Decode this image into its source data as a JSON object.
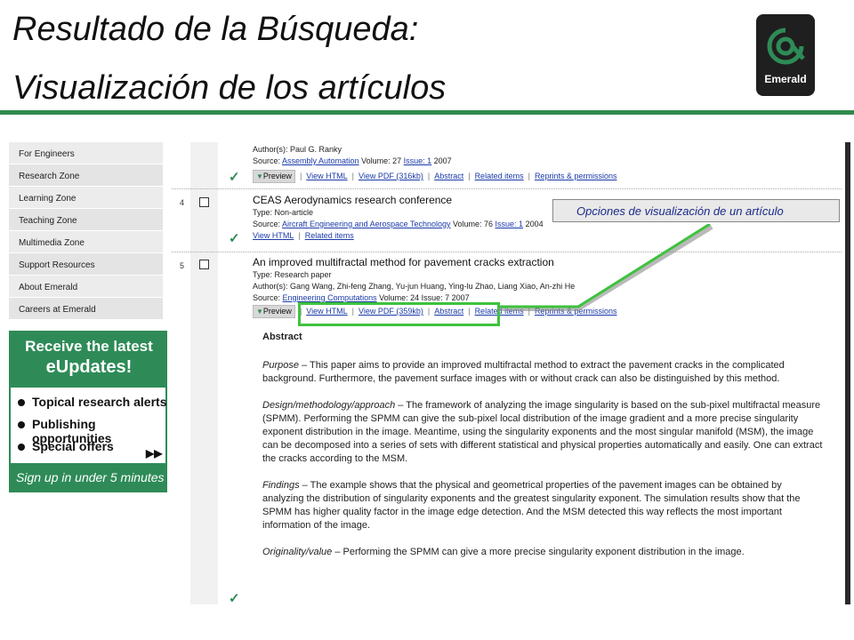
{
  "slide": {
    "title_line1": "Resultado de la Búsqueda:",
    "title_line2": "Visualización de los artículos",
    "logo_text": "Emerald",
    "callout": "Opciones de visualización de un artículo"
  },
  "colors": {
    "accent_green": "#2e8b57",
    "rule_green": "#2f8a4d",
    "link_blue": "#1a3aa8"
  },
  "sidebar": {
    "items": [
      {
        "label": "For Engineers"
      },
      {
        "label": "Research Zone"
      },
      {
        "label": "Learning Zone"
      },
      {
        "label": "Teaching Zone"
      },
      {
        "label": "Multimedia Zone"
      },
      {
        "label": "Support Resources"
      },
      {
        "label": "About Emerald"
      },
      {
        "label": "Careers at Emerald"
      }
    ]
  },
  "promo": {
    "head1": "Receive the latest",
    "head2": "eUpdates!",
    "bullets": [
      "Topical research alerts",
      "Publishing opportunities",
      "Special offers"
    ],
    "footer": "Sign up in under 5 minutes"
  },
  "results": {
    "r3": {
      "authors": "Author(s): Paul G. Ranky",
      "source_label": "Source: ",
      "source_journal": "Assembly Automation",
      "source_volume": " Volume: 27 ",
      "source_issue": "Issue: 1",
      "source_year": " 2007",
      "preview": "Preview",
      "actions": [
        "View HTML",
        "View PDF (316kb)",
        "Abstract",
        "Related items",
        "Reprints & permissions"
      ]
    },
    "r4": {
      "num": "4",
      "title": "CEAS Aerodynamics research conference",
      "type": "Type: Non-article",
      "source_label": "Source: ",
      "source_journal": "Aircraft Engineering and Aerospace Technology",
      "source_volume": " Volume: 76 ",
      "source_issue": "Issue: 1",
      "source_year": " 2004",
      "actions": [
        "View HTML",
        "Related items"
      ]
    },
    "r5": {
      "num": "5",
      "title": "An improved multifractal method for pavement cracks extraction",
      "type": "Type: Research paper",
      "authors": "Author(s): Gang Wang, Zhi-feng Zhang, Yu-jun Huang, Ying-lu Zhao, Liang Xiao, An-zhi He",
      "source_label": "Source: ",
      "source_journal": "Engineering Computations",
      "source_rest": " Volume: 24 Issue: 7 2007",
      "preview": "Preview",
      "actions": [
        "View HTML",
        "View PDF (359kb)",
        "Abstract",
        "Related items",
        "Reprints & permissions"
      ]
    }
  },
  "abstract": {
    "heading": "Abstract",
    "purpose_label": "Purpose",
    "purpose_text": " – This paper aims to provide an improved multifractal method to extract the pavement cracks in the complicated background. Furthermore, the pavement surface images with or without crack can also be distinguished by this method.",
    "design_label": "Design/methodology/approach",
    "design_text": " – The framework of analyzing the image singularity is based on the sub-pixel multifractal measure (SPMM). Performing the SPMM can give the sub-pixel local distribution of the image gradient and a more precise singularity exponent distribution in the image. Meantime, using the singularity exponents and the most singular manifold (MSM), the image can be decomposed into a series of sets with different statistical and physical properties automatically and easily. One can extract the cracks according to the MSM.",
    "findings_label": "Findings",
    "findings_text": " – The example shows that the physical and geometrical properties of the pavement images can be obtained by analyzing the distribution of singularity exponents and the greatest singularity exponent. The simulation results show that the SPMM has higher quality factor in the image edge detection. And the MSM detected this way reflects the most important information of the image.",
    "originality_label": "Originality/value",
    "originality_text": " – Performing the SPMM can give a more precise singularity exponent distribution in the image."
  },
  "icons": [
    "emerald-logo-icon",
    "checkbox-icon",
    "checkmark-icon",
    "bullet-icon",
    "double-arrow-icon",
    "preview-triangle-icon"
  ]
}
